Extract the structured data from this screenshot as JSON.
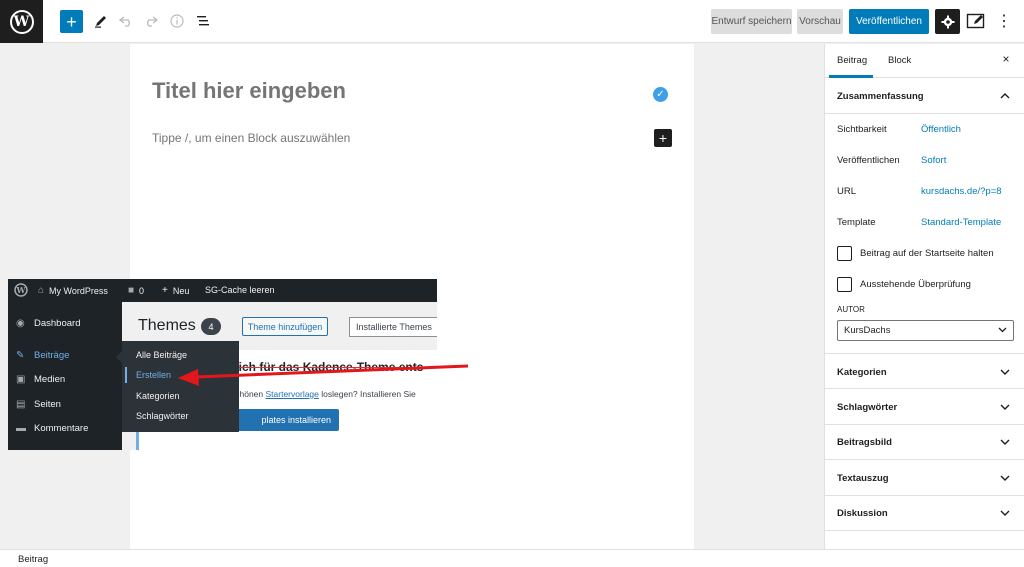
{
  "toolbar": {
    "logo_letter": "W",
    "add_block": "+",
    "tools_icon": "pencil-icon",
    "undo_icon": "undo-icon",
    "redo_icon": "redo-icon",
    "info_icon": "info-icon",
    "list_view_icon": "list-view-icon",
    "save_draft": "Entwurf speichern",
    "preview": "Vorschau",
    "publish": "Veröffentlichen",
    "settings_icon": "gear-icon",
    "more_icon": "more-vertical-icon"
  },
  "editor": {
    "title_placeholder": "Titel hier eingeben",
    "block_placeholder": "Tippe /, um einen Block auszuwählen",
    "block_adder": "+"
  },
  "screenshot": {
    "admin_bar": {
      "site_name": "My WordPress",
      "comments_count": "0",
      "new_label": "Neu",
      "cache_label": "SG-Cache leeren"
    },
    "menu": [
      {
        "label": "Dashboard",
        "icon": "dashboard-icon"
      },
      {
        "label": "Beiträge",
        "icon": "pin-icon",
        "active": true
      },
      {
        "label": "Medien",
        "icon": "media-icon"
      },
      {
        "label": "Seiten",
        "icon": "pages-icon"
      },
      {
        "label": "Kommentare",
        "icon": "comments-icon"
      }
    ],
    "flyout": [
      "Alle Beiträge",
      "Erstellen",
      "Kategorien",
      "Schlagwörter"
    ],
    "flyout_active": "Erstellen",
    "themes_title": "Themes",
    "themes_count": "4",
    "add_theme": "Theme hinzufügen",
    "search_placeholder": "Installierte Themes",
    "notice_heading": "sich für das Kadence-Theme ents",
    "notice_text_before": "schönen ",
    "notice_link": "Startervorlage",
    "notice_text_after": " loslegen? Installieren Sie",
    "notice_button": "plates installieren"
  },
  "sidebar": {
    "tab_post": "Beitrag",
    "tab_block": "Block",
    "close": "×",
    "summary_title": "Zusammenfassung",
    "rows": [
      {
        "label": "Sichtbarkeit",
        "value": "Öffentlich"
      },
      {
        "label": "Veröffentlichen",
        "value": "Sofort"
      },
      {
        "label": "URL",
        "value": "kursdachs.de/?p=8"
      },
      {
        "label": "Template",
        "value": "Standard-Template"
      }
    ],
    "checkboxes": [
      {
        "label": "Beitrag auf der Startseite halten",
        "checked": false
      },
      {
        "label": "Ausstehende Überprüfung",
        "checked": false
      }
    ],
    "author_label": "AUTOR",
    "author_value": "KursDachs",
    "panels": [
      "Kategorien",
      "Schlagwörter",
      "Beitragsbild",
      "Textauszug",
      "Diskussion"
    ]
  },
  "footer": {
    "breadcrumb": "Beitrag"
  },
  "colors": {
    "accent": "#007cba",
    "dark": "#1e1e1e",
    "annotation_arrow": "#e3161b"
  }
}
